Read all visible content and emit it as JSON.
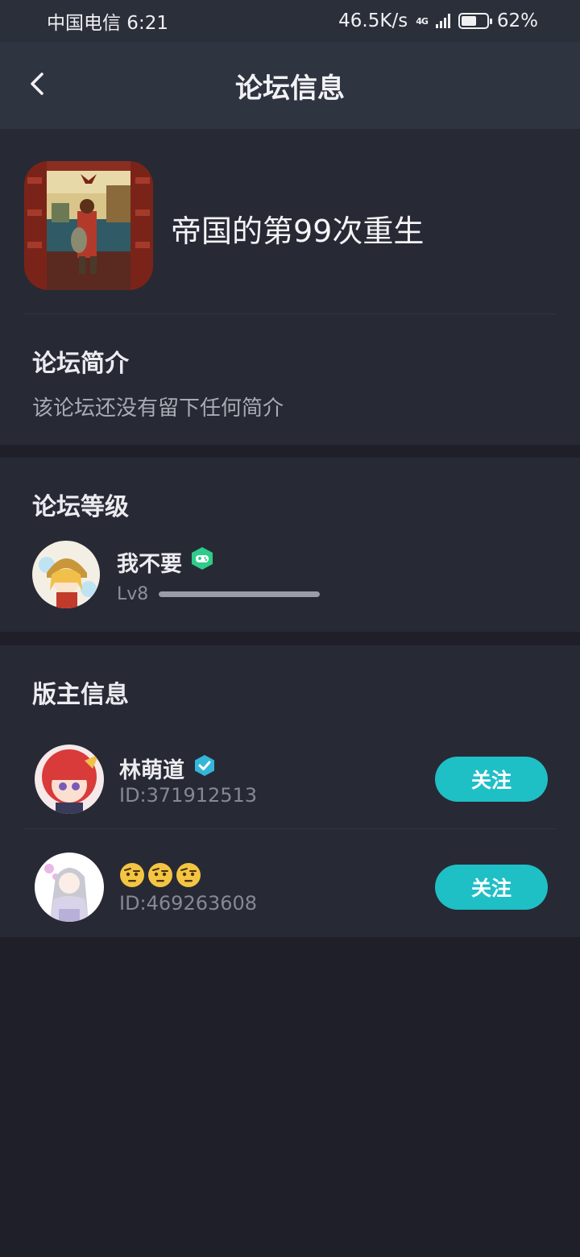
{
  "status_bar": {
    "carrier_time": "中国电信 6:21",
    "net_speed": "46.5K/s",
    "net_type": "4G",
    "battery": "62%",
    "battery_level": 0.62
  },
  "header": {
    "title": "论坛信息",
    "back_icon": "chevron-left-icon"
  },
  "forum": {
    "name": "帝国的第99次重生",
    "intro_title": "论坛简介",
    "intro_text": "该论坛还没有留下任何简介"
  },
  "level_section": {
    "title": "论坛等级",
    "user_name": "我不要",
    "badge_icon": "game-controller-icon",
    "level": "Lv8",
    "progress": 1.0
  },
  "moderators": {
    "title": "版主信息",
    "items": [
      {
        "name": "林萌道",
        "id": "ID:371912513",
        "follow": "关注",
        "verified": true
      },
      {
        "name": "",
        "id": "ID:469263608",
        "follow": "关注",
        "verified": false
      }
    ]
  },
  "colors": {
    "accent": "#1fbfc6",
    "background": "#1f1f29",
    "card": "#272a35",
    "header": "#2f3441",
    "badge_green": "#2ecc8a"
  }
}
